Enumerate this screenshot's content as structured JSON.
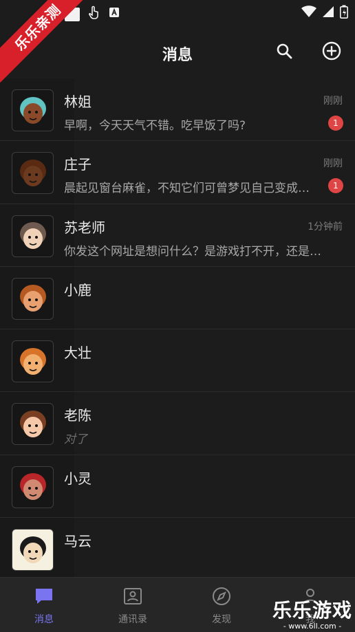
{
  "watermark": {
    "ribbon": "乐乐亲测",
    "brand": "乐乐游戏",
    "url": "- www.6ll.com -"
  },
  "header": {
    "title": "消息",
    "search_icon": "search-icon",
    "add_icon": "plus-circle-icon"
  },
  "conversations": [
    {
      "name": "林姐",
      "time": "刚刚",
      "preview": "早啊，今天天气不错。吃早饭了吗?",
      "unread": "1",
      "italic": false,
      "avatar_colors": {
        "skin": "#8a4a2a",
        "hair": "#62c4c2",
        "bg": "#161616"
      }
    },
    {
      "name": "庄子",
      "time": "刚刚",
      "preview": "晨起见窗台麻雀，不知它们可曾梦见自己变成了人？",
      "unread": "1",
      "italic": false,
      "avatar_colors": {
        "skin": "#6b3a1f",
        "hair": "#5a2a12",
        "bg": "#161616"
      }
    },
    {
      "name": "苏老师",
      "time": "1分钟前",
      "preview": "你发这个网址是想问什么？是游戏打不开，还是想问玩法？",
      "unread": "",
      "italic": false,
      "avatar_colors": {
        "skin": "#f0d2b8",
        "hair": "#6e5a4e",
        "bg": "#161616"
      }
    },
    {
      "name": "小鹿",
      "time": "",
      "preview": "",
      "unread": "",
      "italic": false,
      "avatar_colors": {
        "skin": "#e8a070",
        "hair": "#b65a22",
        "bg": "#161616"
      }
    },
    {
      "name": "大壮",
      "time": "",
      "preview": "",
      "unread": "",
      "italic": false,
      "avatar_colors": {
        "skin": "#f2b070",
        "hair": "#d8742a",
        "bg": "#161616"
      }
    },
    {
      "name": "老陈",
      "time": "",
      "preview": "对了",
      "unread": "",
      "italic": true,
      "avatar_colors": {
        "skin": "#f4c8a8",
        "hair": "#7a3e22",
        "bg": "#161616"
      }
    },
    {
      "name": "小灵",
      "time": "",
      "preview": "",
      "unread": "",
      "italic": false,
      "avatar_colors": {
        "skin": "#d08a72",
        "hair": "#b8262a",
        "bg": "#161616"
      }
    },
    {
      "name": "马云",
      "time": "",
      "preview": "",
      "unread": "",
      "italic": false,
      "avatar_colors": {
        "skin": "#f0d8b8",
        "hair": "#1a1a1a",
        "bg": "#f6f0e0"
      }
    }
  ],
  "bottom_nav": [
    {
      "label": "消息",
      "icon": "chat-bubble-icon",
      "active": true
    },
    {
      "label": "通讯录",
      "icon": "contacts-icon",
      "active": false
    },
    {
      "label": "发现",
      "icon": "compass-icon",
      "active": false
    },
    {
      "label": "我",
      "icon": "person-icon",
      "active": false
    }
  ],
  "colors": {
    "accent": "#7b74f0",
    "badge": "#e04545",
    "background": "#1c1c1c"
  }
}
